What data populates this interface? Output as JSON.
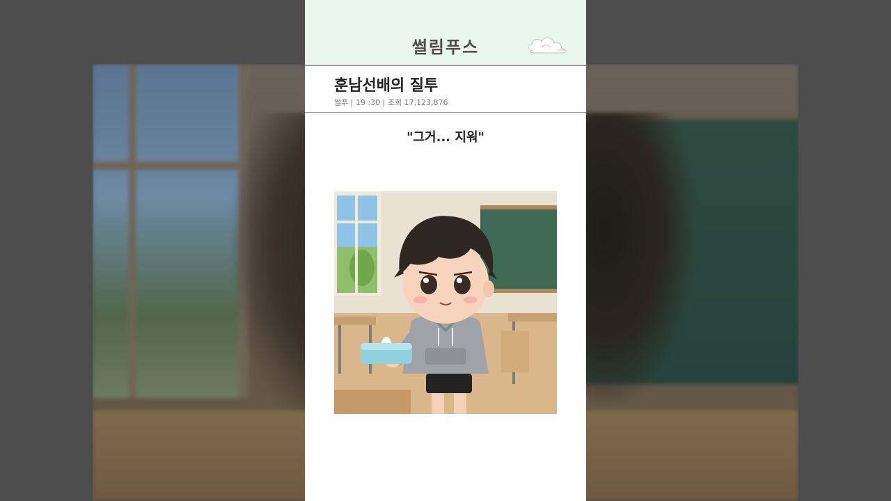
{
  "brand": {
    "name": "썰림푸스",
    "logo_icon": "cloud-icon"
  },
  "post": {
    "title": "훈남선배의 질투",
    "meta": "썰푸 | 19 :30 | 조회 17,123,876",
    "caption": "\"그거... 지워\""
  },
  "image": {
    "subject": "illustration",
    "icon": "illustration-image"
  },
  "colors": {
    "header_bg": "#e9f8ee",
    "card_bg": "#ffffff",
    "page_bg": "#4b4b4b",
    "title_text": "#222222",
    "meta_text": "#7a7a7a"
  }
}
